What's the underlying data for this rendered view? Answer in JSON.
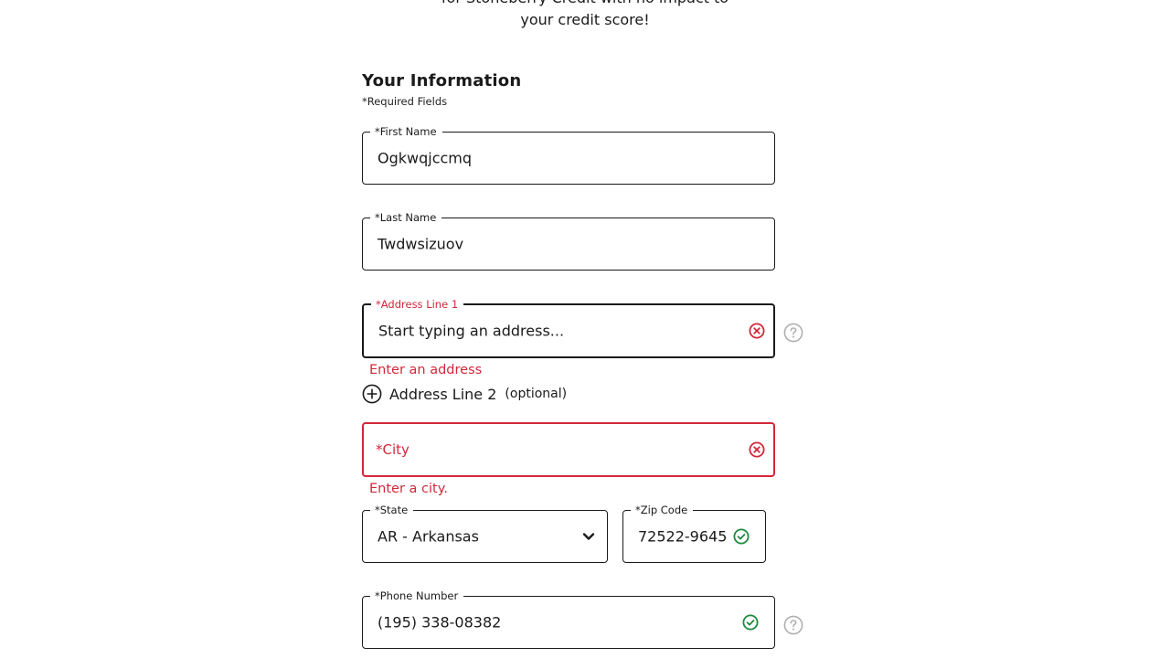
{
  "intro": {
    "line1": "for Stoneberry Credit with no impact to",
    "line2": "your credit score!"
  },
  "section": {
    "title": "Your Information",
    "required_note": "*Required Fields"
  },
  "fields": {
    "first_name": {
      "label": "*First Name",
      "value": "Ogkwqjccmq"
    },
    "last_name": {
      "label": "*Last Name",
      "value": "Twdwsizuov"
    },
    "address_line1": {
      "label": "*Address Line 1",
      "placeholder": "Start typing an address...",
      "error": "Enter an address"
    },
    "address_line2": {
      "label": "Address Line 2",
      "optional": "(optional)"
    },
    "city": {
      "placeholder": "*City",
      "error": "Enter a city."
    },
    "state": {
      "label": "*State",
      "value": "AR - Arkansas"
    },
    "zip": {
      "label": "*Zip Code",
      "value": "72522-9645"
    },
    "phone": {
      "label": "*Phone Number",
      "value": "(195) 338-08382"
    }
  },
  "colors": {
    "error": "#d3273a",
    "success": "#1e8a3e",
    "help": "#b0b0b0"
  },
  "icons": {
    "error": "x-circle-icon",
    "success": "check-circle-icon",
    "help": "question-circle-icon",
    "add": "plus-circle-icon",
    "dropdown": "chevron-down-icon"
  }
}
